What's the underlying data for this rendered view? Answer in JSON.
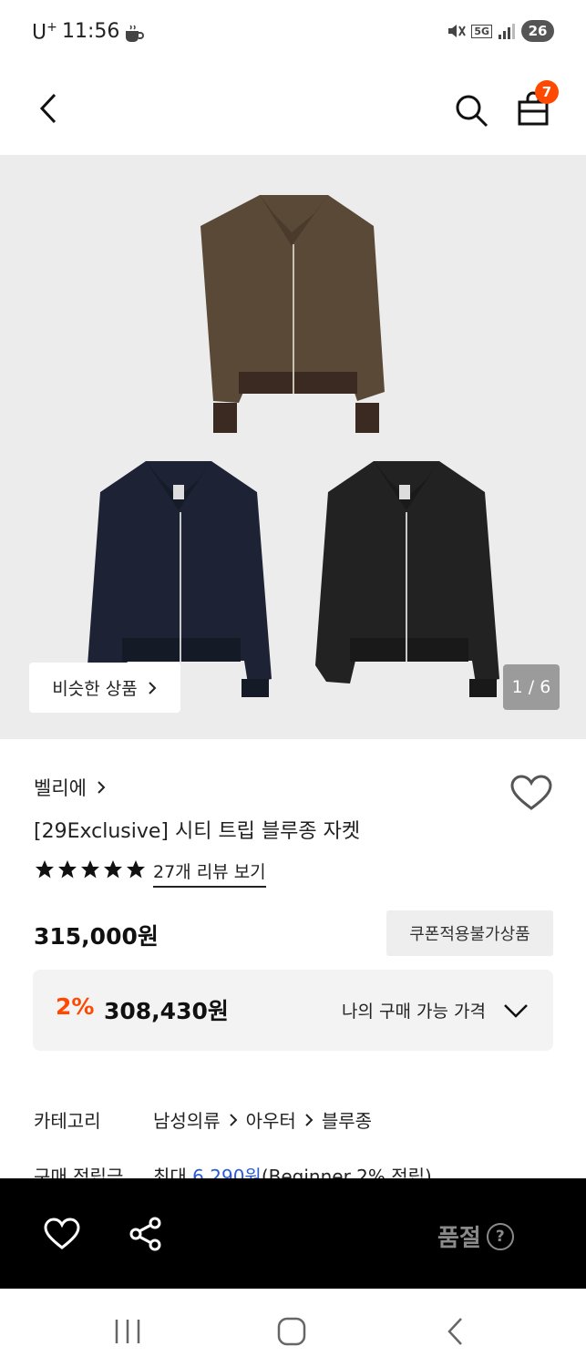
{
  "status_bar": {
    "carrier": "U",
    "carrier_sup": "+",
    "time": "11:56",
    "battery": "26",
    "network": "5G"
  },
  "header": {
    "back_icon": "chevron-left-icon",
    "search_icon": "search-icon",
    "cart_icon": "shopping-bag-icon",
    "cart_count": "7"
  },
  "gallery": {
    "similar_button": "비슷한 상품",
    "counter": "1 / 6"
  },
  "product": {
    "brand": "벨리에",
    "title": "[29Exclusive] 시티 트립 블루종 자켓",
    "rating": 5,
    "review_link": "27개 리뷰 보기",
    "price": "315,000원",
    "coupon_badge": "쿠폰적용불가상품",
    "my_price": {
      "discount": "2%",
      "price": "308,430원",
      "label": "나의 구매 가능 가격"
    },
    "category_label": "카테고리",
    "category_path": [
      "남성의류",
      "아우터",
      "블루종"
    ],
    "points_label": "구매 적립금",
    "points_prefix": "최대 ",
    "points_amount": "6,290원",
    "points_suffix": "(Beginner 2% 적립)"
  },
  "action_bar": {
    "status_label": "품절",
    "help_icon": "?"
  },
  "colors": {
    "accent": "#ff4800",
    "link_blue": "#2a5bd7",
    "gallery_bg": "#ececec",
    "action_bar_bg": "#000000"
  }
}
